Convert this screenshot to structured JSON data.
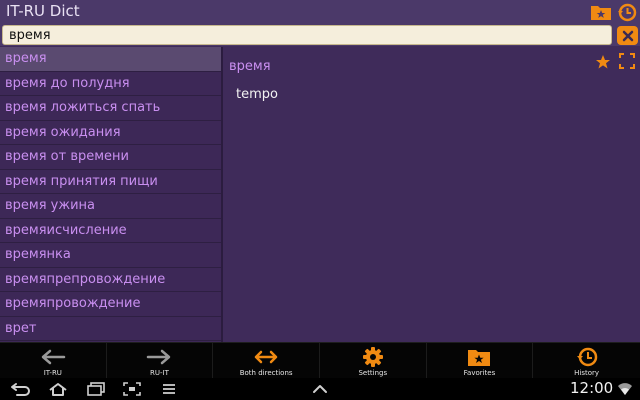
{
  "app": {
    "title": "IT-RU Dict"
  },
  "search": {
    "value": "время"
  },
  "word_list": [
    "время",
    "время до полудня",
    "время ложиться спать",
    "время ожидания",
    "время от времени",
    "время принятия пищи",
    "время ужина",
    "времяисчисление",
    "времянка",
    "времяпрепровождение",
    "времяпровождение",
    "врет"
  ],
  "detail": {
    "word": "время",
    "translation": "tempo"
  },
  "actions": {
    "it_ru": "IT-RU",
    "ru_it": "RU-IT",
    "both": "Both directions",
    "settings": "Settings",
    "favorites": "Favorites",
    "history": "History"
  },
  "system": {
    "clock": "12:00"
  },
  "icons": {
    "favorites_folder": "folder-star-icon",
    "history": "clock-history-icon",
    "clear": "clear-icon",
    "star": "star-icon",
    "fullscreen": "fullscreen-icon",
    "back": "back-icon",
    "home": "home-icon",
    "recent": "recent-apps-icon",
    "screenshot": "screenshot-icon",
    "menu": "menu-icon",
    "up": "chevron-up-icon",
    "wifi": "wifi-icon"
  },
  "colors": {
    "background": "#3f2b5a",
    "accent": "#f08a12",
    "list_text": "#c98ff0",
    "selected_row": "#5a4a70"
  }
}
